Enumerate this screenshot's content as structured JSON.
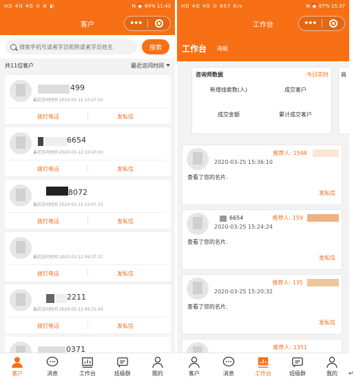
{
  "left": {
    "status": {
      "left": "HD 4G 4G ⊙ ⊗ ◐",
      "speed": "1.2 K/s",
      "right": "N ⏰ 84% 11:43"
    },
    "title": "客户",
    "search": {
      "placeholder": "搜索手机号或者学员昵称或者学员姓名",
      "button": "搜索"
    },
    "count": "共11位客户",
    "sort": "最近访问时间",
    "cards": [
      {
        "num": "499",
        "time": "最近访问时间 2020-03-12 10:27:50"
      },
      {
        "num": "6654",
        "time": "最近访问时间 2020-03-12 10:10:20"
      },
      {
        "num": "8072",
        "time": "最近访问时间 2020-03-12 10:07:15"
      },
      {
        "num": "",
        "time": "最近访问时间 2020-03-12 09:37:27"
      },
      {
        "num": "2211",
        "time": "最近访问时间 2020-03-12 09:31:43"
      },
      {
        "num": "0371",
        "time": ""
      }
    ],
    "call": "拨打电话",
    "msg": "发私信",
    "tabs": [
      "客户",
      "消息",
      "工作台",
      "班级群",
      "我的"
    ]
  },
  "right": {
    "status": {
      "left": "HD 4G 4G ⊙ 807 K/s",
      "right": "N ⏰ 67% 15:37"
    },
    "title": "工作台",
    "tab_main": "工作台",
    "tab_sub": "海报",
    "stats": {
      "header": "咨询师数据",
      "realtime": "今日实时",
      "items": [
        "新增线索数(人)",
        "成交客户",
        "成交金额",
        "累计成交客户"
      ],
      "side": "商"
    },
    "leads": [
      {
        "name": "",
        "ref": "推荐人: 1598",
        "time": "2020-03-25 15:36:10",
        "text": "查看了您的名片.",
        "pm": "发私信"
      },
      {
        "name": "6654",
        "ref": "推荐人: 159",
        "time": "2020-03-25 15:24:24",
        "text": "查看了您的名片.",
        "pm": "发私信"
      },
      {
        "name": "",
        "ref": "推荐人: 135",
        "time": "2020-03-25 15:20:32",
        "text": "查看了您的名片.",
        "pm": "发私信"
      },
      {
        "name": "",
        "ref": "推荐人: 1351",
        "time": "",
        "text": "",
        "pm": ""
      }
    ],
    "tabs": [
      "客户",
      "消息",
      "工作台",
      "班级群",
      "我的"
    ]
  },
  "colors": {
    "accent": "#f77016"
  }
}
